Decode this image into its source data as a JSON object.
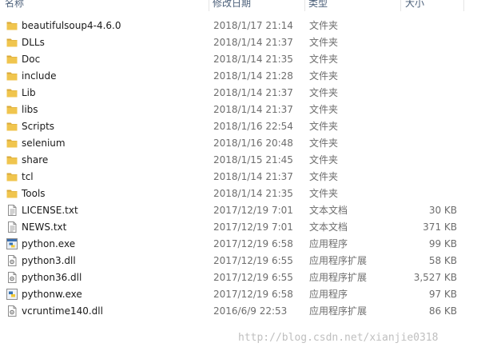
{
  "columns": {
    "name": "名称",
    "date": "修改日期",
    "type": "类型",
    "size": "大小"
  },
  "rows": [
    {
      "name": "beautifulsoup4-4.6.0",
      "date": "2018/1/17 21:14",
      "type": "文件夹",
      "size": "",
      "icon": "folder-icon"
    },
    {
      "name": "DLLs",
      "date": "2018/1/14 21:37",
      "type": "文件夹",
      "size": "",
      "icon": "folder-icon"
    },
    {
      "name": "Doc",
      "date": "2018/1/14 21:35",
      "type": "文件夹",
      "size": "",
      "icon": "folder-icon"
    },
    {
      "name": "include",
      "date": "2018/1/14 21:28",
      "type": "文件夹",
      "size": "",
      "icon": "folder-icon"
    },
    {
      "name": "Lib",
      "date": "2018/1/14 21:37",
      "type": "文件夹",
      "size": "",
      "icon": "folder-icon"
    },
    {
      "name": "libs",
      "date": "2018/1/14 21:37",
      "type": "文件夹",
      "size": "",
      "icon": "folder-icon"
    },
    {
      "name": "Scripts",
      "date": "2018/1/16 22:54",
      "type": "文件夹",
      "size": "",
      "icon": "folder-icon"
    },
    {
      "name": "selenium",
      "date": "2018/1/16 20:48",
      "type": "文件夹",
      "size": "",
      "icon": "folder-icon"
    },
    {
      "name": "share",
      "date": "2018/1/15 21:45",
      "type": "文件夹",
      "size": "",
      "icon": "folder-icon"
    },
    {
      "name": "tcl",
      "date": "2018/1/14 21:37",
      "type": "文件夹",
      "size": "",
      "icon": "folder-icon"
    },
    {
      "name": "Tools",
      "date": "2018/1/14 21:35",
      "type": "文件夹",
      "size": "",
      "icon": "folder-icon"
    },
    {
      "name": "LICENSE.txt",
      "date": "2017/12/19 7:01",
      "type": "文本文档",
      "size": "30 KB",
      "icon": "text-file-icon"
    },
    {
      "name": "NEWS.txt",
      "date": "2017/12/19 7:01",
      "type": "文本文档",
      "size": "371 KB",
      "icon": "text-file-icon"
    },
    {
      "name": "python.exe",
      "date": "2017/12/19 6:58",
      "type": "应用程序",
      "size": "99 KB",
      "icon": "python-exe-icon"
    },
    {
      "name": "python3.dll",
      "date": "2017/12/19 6:55",
      "type": "应用程序扩展",
      "size": "58 KB",
      "icon": "dll-file-icon"
    },
    {
      "name": "python36.dll",
      "date": "2017/12/19 6:55",
      "type": "应用程序扩展",
      "size": "3,527 KB",
      "icon": "dll-file-icon"
    },
    {
      "name": "pythonw.exe",
      "date": "2017/12/19 6:58",
      "type": "应用程序",
      "size": "97 KB",
      "icon": "pythonw-exe-icon"
    },
    {
      "name": "vcruntime140.dll",
      "date": "2016/6/9 22:53",
      "type": "应用程序扩展",
      "size": "86 KB",
      "icon": "dll-file-icon"
    }
  ],
  "watermark": "http://blog.csdn.net/xianjie0318",
  "colors": {
    "folder": "#f0c54e",
    "folder_dark": "#d9a93a",
    "header_text": "#4c607a",
    "secondary_text": "#6d6d6d",
    "watermark": "#bfbfbf"
  }
}
